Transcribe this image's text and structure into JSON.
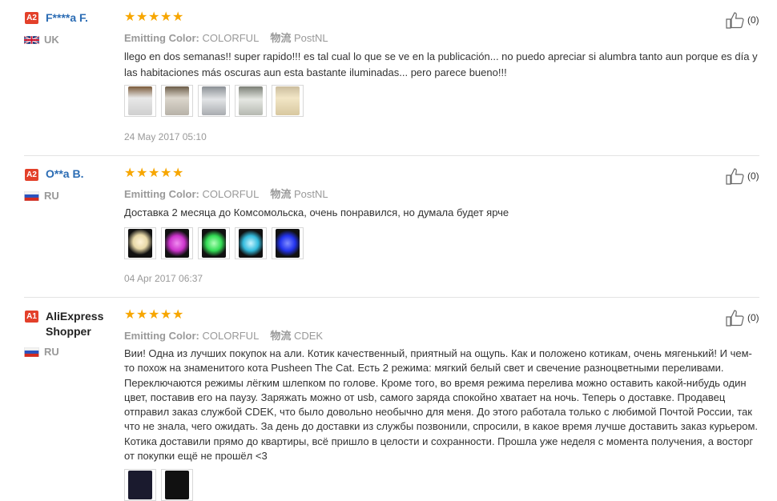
{
  "reviews": [
    {
      "badge": "A2",
      "name": "F****a F.",
      "country": "UK",
      "flag": "uk",
      "stars": 5,
      "color_label": "Emitting Color:",
      "color_value": "COLORFUL",
      "ship_label": "物流",
      "ship_value": "PostNL",
      "text": "llego en dos semanas!! super rapido!!! es tal cual lo que se ve en la publicación... no puedo apreciar si alumbra tanto aun porque es día y las habitaciones más oscuras aun esta bastante iluminadas... pero parece bueno!!!",
      "photos": [
        "#c9c9c9",
        "#b7b2a8",
        "#a9acb0",
        "#b6b9b1",
        "#d8c8a0"
      ],
      "date": "24 May 2017 05:10",
      "likes": "(0)"
    },
    {
      "badge": "A2",
      "name": "O**a B.",
      "country": "RU",
      "flag": "ru",
      "stars": 5,
      "color_label": "Emitting Color:",
      "color_value": "COLORFUL",
      "ship_label": "物流",
      "ship_value": "PostNL",
      "text": "Доставка 2 месяца до Комсомольска, очень понравился, но думала будет ярче",
      "photos": [
        "#f2e7c4",
        "#cc33cc",
        "#33dd55",
        "#33bbdd",
        "#2233ee"
      ],
      "date": "04 Apr 2017 06:37",
      "likes": "(0)"
    },
    {
      "badge": "A1",
      "name": "AliExpress Shopper",
      "country": "RU",
      "flag": "ru",
      "stars": 5,
      "color_label": "Emitting Color:",
      "color_value": "COLORFUL",
      "ship_label": "物流",
      "ship_value": "CDEK",
      "text": "Вии! Одна из лучших покупок на али. Котик качественный, приятный на ощупь. Как и положено котикам, очень мягенький! И чем-то похож на знаменитого кота Pusheen The Cat. Есть 2 режима: мягкий белый свет и свечение разноцветными переливами. Переключаются режимы лёгким шлепком по голове. Кроме того, во время режима перелива можно оставить какой-нибудь один цвет, поставив его на паузу. Заряжать можно от usb, самого заряда спокойно хватает на ночь. Теперь о доставке. Продавец отправил заказ службой CDEK, что было довольно необычно для меня. До этого работала только с любимой Почтой России, так что не знала, чего ожидать. За день до доставки из службы позвонили, спросили, в какое время лучше доставить заказ курьером. Котика доставили прямо до квартиры, всё пришло в целости и сохранности. Прошла уже неделя с момента получения, а восторг от покупки ещё не прошёл <3",
      "photos": [
        "#1a1a2e",
        "#111111"
      ],
      "date": "",
      "likes": "(0)"
    }
  ]
}
